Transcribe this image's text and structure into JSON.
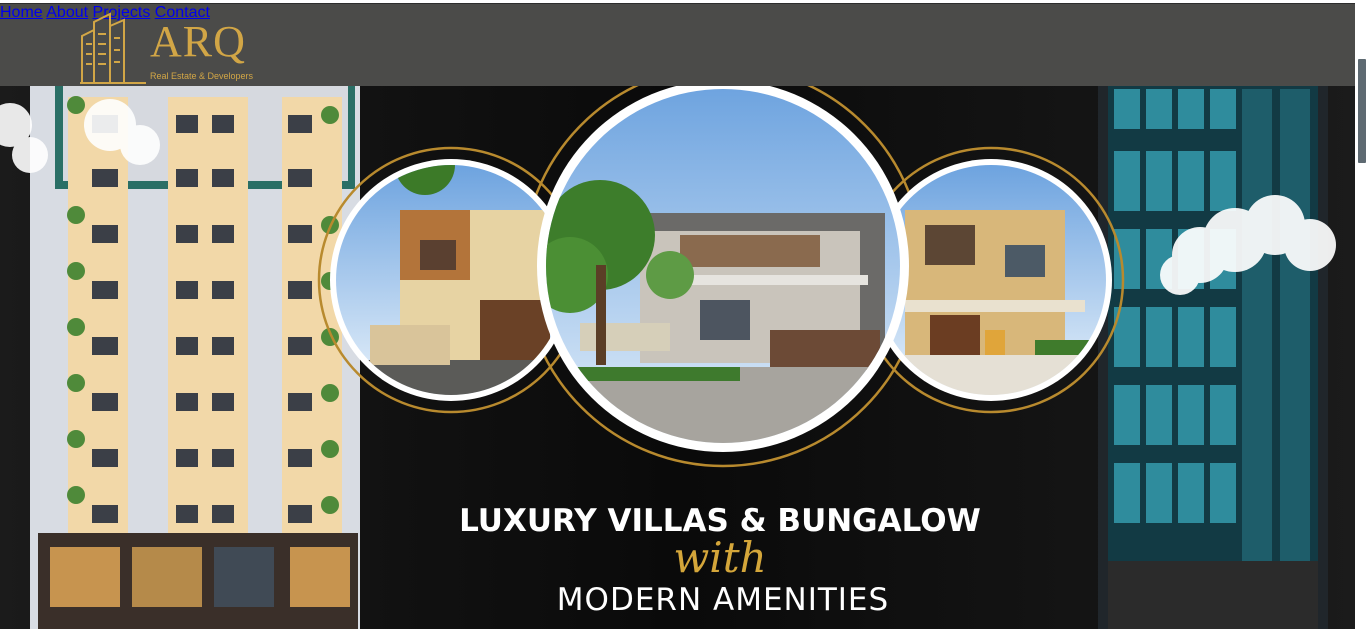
{
  "brand": {
    "name": "ARQ",
    "tagline": "Real Estate & Developers",
    "color": "#d2a646"
  },
  "nav": {
    "items": [
      {
        "label": "Home"
      },
      {
        "label": "About"
      },
      {
        "label": "Projects"
      },
      {
        "label": "Contact"
      }
    ]
  },
  "hero": {
    "headline": "LUXURY VILLAS & BUNGALOW",
    "script": "with",
    "subline": "MODERN AMENITIES",
    "accent": "#d4a63a"
  },
  "colors": {
    "header_bg": "#4b4b49",
    "hero_bg": "#0c0c0c"
  }
}
